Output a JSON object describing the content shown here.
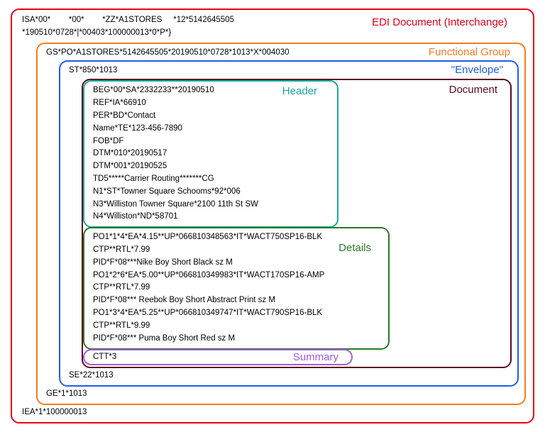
{
  "interchange": {
    "label": "EDI Document (Interchange)",
    "top1": "ISA*00*        *00*        *ZZ*A1STORES     *12*5142645505",
    "top2": "*190510*0728*|*00403*100000013*0*P*}",
    "bottom": "IEA*1*100000013"
  },
  "funcgroup": {
    "label": "Functional Group",
    "top": "GS*PO*A1STORES*5142645505*20190510*0728*1013*X*004030",
    "bottom": "GE*1*1013"
  },
  "envelope": {
    "label": "\"Envelope\"",
    "top": "ST*850*1013",
    "bottom": "SE*22*1013"
  },
  "document": {
    "label": "Document"
  },
  "header": {
    "label": "Header",
    "l1": "BEG*00*SA*2332233**20190510",
    "l2": "REF*IA*66910",
    "l3": "PER*BD*Contact",
    "l4": "Name*TE*123-456-7890",
    "l5": "FOB*DF",
    "l6": "DTM*010*20190517",
    "l7": "DTM*001*20190525",
    "l8": "TD5*****Carrier Routing*******CG",
    "l9": "N1*ST*Towner Square Schooms*92*006",
    "l10": "N3*Williston Towner Square*2100 11th St SW",
    "l11": "N4*Williston*ND*58701"
  },
  "details": {
    "label": "Details",
    "l1": "PO1*1*4*EA*4.15**UP*066810348563*IT*WACT750SP16-BLK",
    "l2": "CTP**RTL*7.99",
    "l3": "PID*F*08***Nike Boy Short Black sz M",
    "l4": "PO1*2*6*EA*5.00**UP*066810349983*IT*WACT170SP16-AMP",
    "l5": "CTP**RTL*7.99",
    "l6": "PID*F*08*** Reebok Boy Short Abstract Print sz M",
    "l7": "PO1*3*4*EA*5.25**UP*066810349747*IT*WACT790SP16-BLK",
    "l8": "CTP**RTL*9.99",
    "l9": "PID*F*08*** Puma Boy Short Red sz M"
  },
  "summary": {
    "label": "Summary",
    "l1": "CTT*3"
  }
}
